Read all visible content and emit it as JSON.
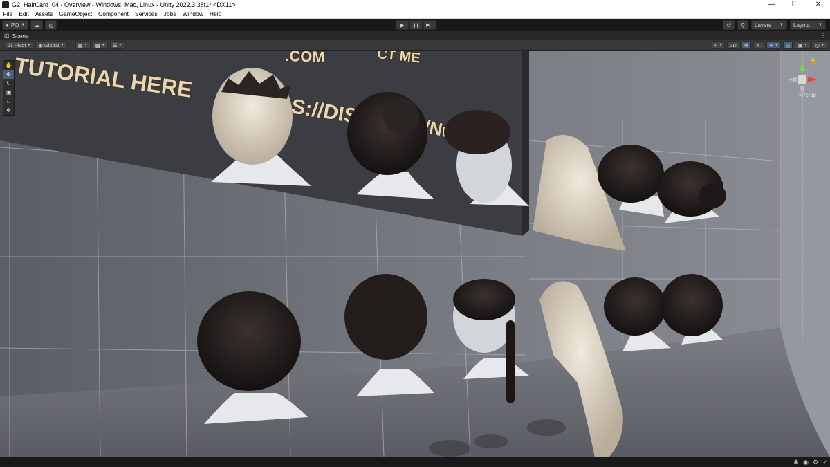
{
  "window": {
    "title": "G2_HairCard_04 - Overview - Windows, Mac, Linux - Unity 2022.3.38f1* <DX11>",
    "controls": [
      "—",
      "❐",
      "✕"
    ]
  },
  "menu": [
    "File",
    "Edit",
    "Assets",
    "GameObject",
    "Component",
    "Services",
    "Jobs",
    "Window",
    "Help"
  ],
  "toolbar": {
    "account_label": "PQ",
    "layers_label": "Layers",
    "layout_label": "Layout",
    "play_icons": [
      "▶",
      "❚❚",
      "▶▏"
    ]
  },
  "scene": {
    "tab_label": "Scene",
    "pivot_label": "Pivot",
    "global_label": "Global",
    "mode_2d": "2D",
    "persp_label": "<Persp"
  },
  "viewport_text": {
    "line1": "TUTORIAL HERE",
    "line2": "S://DIS",
    "line3": "/Nw",
    "com_text": ".COM",
    "contact_text": "CT ME"
  },
  "colors": {
    "accent": "#46607c",
    "wall": "#6e7178",
    "banner": "#3a3c41",
    "banner_text": "#e8d6b2"
  }
}
